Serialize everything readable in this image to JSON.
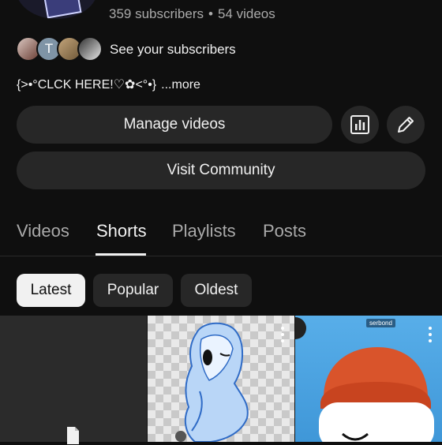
{
  "channel": {
    "subscribers": "359 subscribers",
    "separator": "•",
    "videos": "54 videos"
  },
  "subscribers_row": {
    "avatars": [
      {
        "letter": ""
      },
      {
        "letter": "T"
      },
      {
        "letter": ""
      },
      {
        "letter": ""
      }
    ],
    "label": "See your subscribers"
  },
  "description": {
    "text": "{>•°CLCK HERE!♡✿<°•}",
    "more": "...more"
  },
  "actions": {
    "manage_videos": "Manage videos",
    "visit_community": "Visit Community",
    "analytics_icon": "bar-chart-icon",
    "edit_icon": "pencil-icon"
  },
  "tabs": [
    {
      "label": "Videos",
      "selected": false
    },
    {
      "label": "Shorts",
      "selected": true
    },
    {
      "label": "Playlists",
      "selected": false
    },
    {
      "label": "Posts",
      "selected": false
    }
  ],
  "filters": [
    {
      "label": "Latest",
      "selected": true
    },
    {
      "label": "Popular",
      "selected": false
    },
    {
      "label": "Oldest",
      "selected": false
    }
  ],
  "shorts": [
    {
      "icon": "document-icon"
    },
    {
      "icon": "more-vert-icon"
    },
    {
      "icon": "more-vert-icon",
      "tag": "serbond"
    }
  ],
  "colors": {
    "background": "#0f0f0f",
    "button_bg": "#272727",
    "text_primary": "#f1f1f1",
    "text_secondary": "#aaaaaa",
    "chip_selected_bg": "#f1f1f1"
  }
}
